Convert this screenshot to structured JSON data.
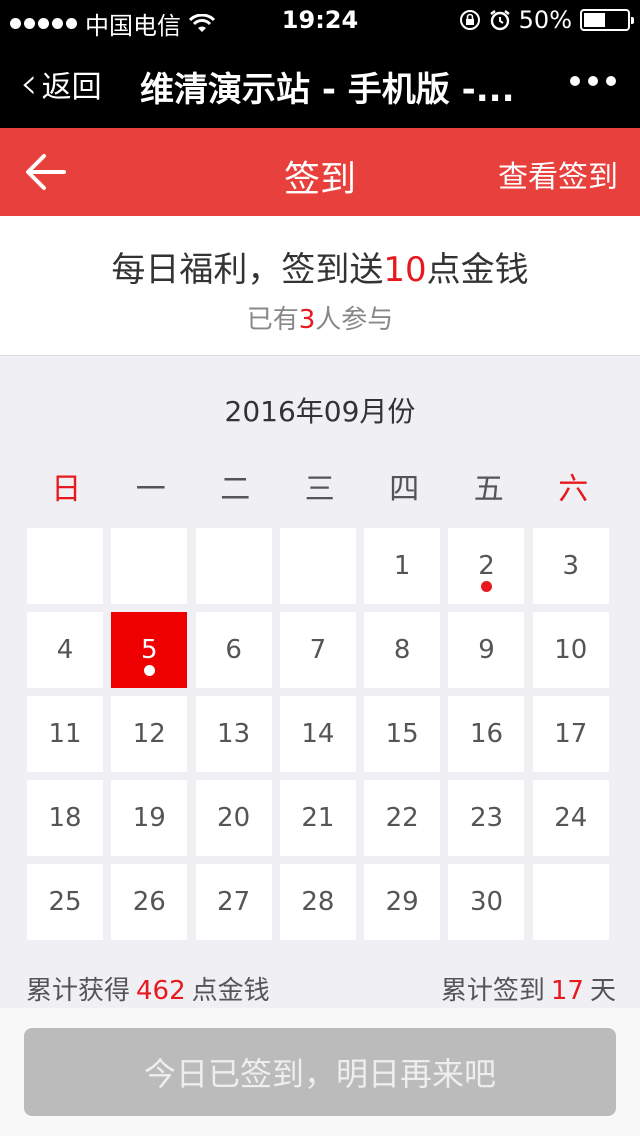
{
  "status_bar": {
    "carrier": "中国电信",
    "time": "19:24",
    "battery": "50%",
    "battery_level": 0.5
  },
  "wechat_nav": {
    "back_label": "返回",
    "title": "维清演示站 - 手机版 -..."
  },
  "header": {
    "title": "签到",
    "view_link": "查看签到"
  },
  "intro": {
    "headline_pre": "每日福利，签到送",
    "headline_num": "10",
    "headline_post": "点金钱",
    "sub_pre": "已有",
    "sub_num": "3",
    "sub_post": "人参与"
  },
  "calendar": {
    "month": "2016年09月份",
    "weekdays": [
      "日",
      "一",
      "二",
      "三",
      "四",
      "五",
      "六"
    ],
    "leading_empty": 4,
    "days": [
      "1",
      "2",
      "3",
      "4",
      "5",
      "6",
      "7",
      "8",
      "9",
      "10",
      "11",
      "12",
      "13",
      "14",
      "15",
      "16",
      "17",
      "18",
      "19",
      "20",
      "21",
      "22",
      "23",
      "24",
      "25",
      "26",
      "27",
      "28",
      "29",
      "30"
    ],
    "today": "5",
    "signed_days": [
      "2",
      "5"
    ]
  },
  "stats": {
    "gold_label_pre": "累计获得",
    "gold_value": "462",
    "gold_label_post": "点金钱",
    "days_label_pre": "累计签到",
    "days_value": "17",
    "days_label_post": "天"
  },
  "sign_button": "今日已签到，明日再来吧"
}
